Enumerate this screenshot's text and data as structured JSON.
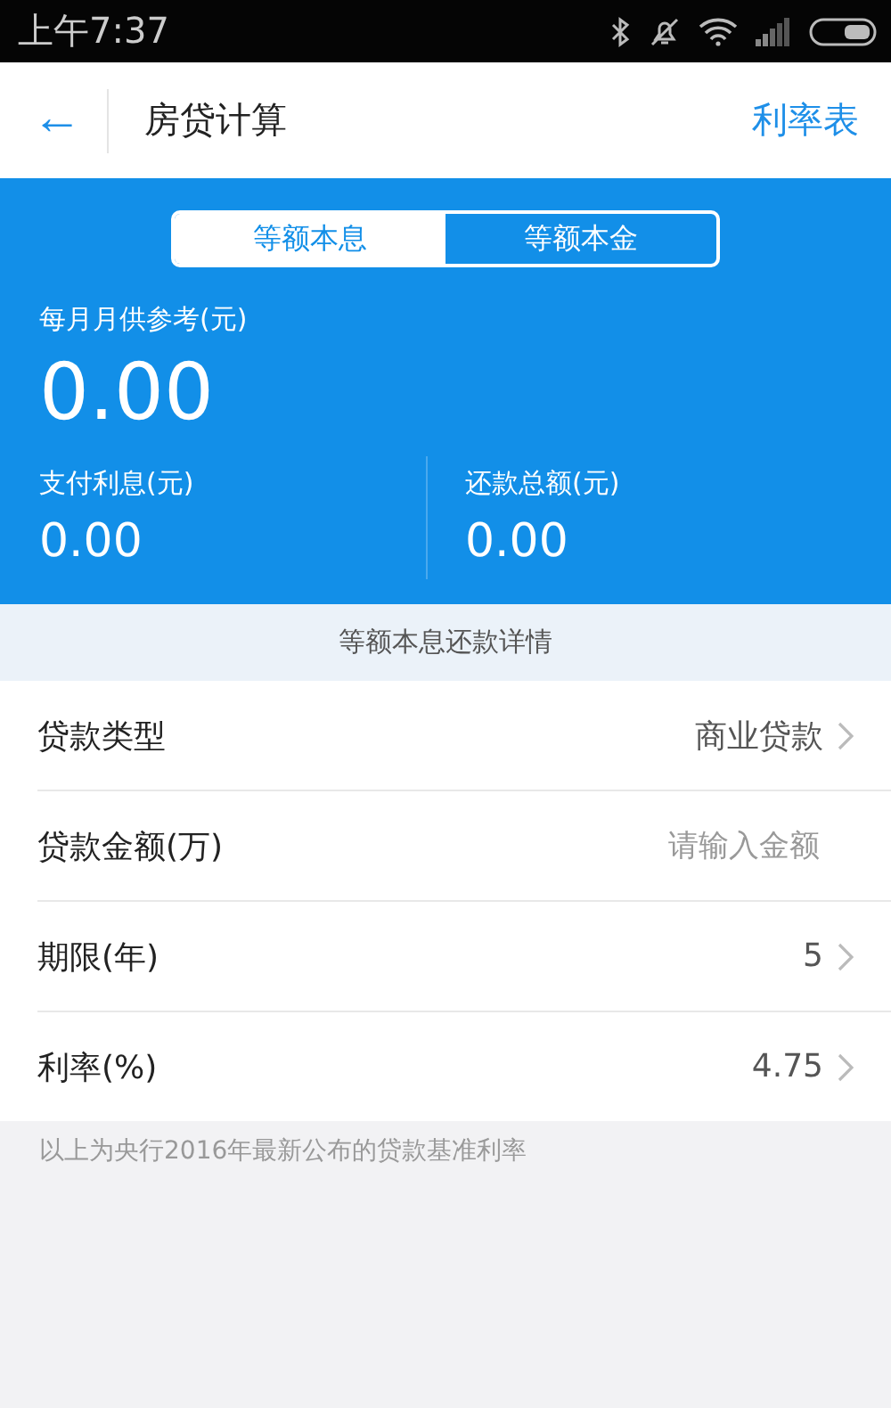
{
  "status_bar": {
    "time": "上午7:37"
  },
  "header": {
    "back": "←",
    "title": "房贷计算",
    "action": "利率表"
  },
  "tabs": [
    {
      "label": "等额本息",
      "selected": true
    },
    {
      "label": "等额本金",
      "selected": false
    }
  ],
  "summary": {
    "main_label": "每月月供参考(元)",
    "main_value": "0.00",
    "items": [
      {
        "label": "支付利息(元)",
        "value": "0.00"
      },
      {
        "label": "还款总额(元)",
        "value": "0.00"
      }
    ]
  },
  "details_link": "等额本息还款详情",
  "rows": [
    {
      "kind": "select",
      "label": "贷款类型",
      "value": "商业贷款"
    },
    {
      "kind": "input",
      "label": "贷款金额(万)",
      "placeholder": "请输入金额"
    },
    {
      "kind": "select",
      "label": "期限(年)",
      "value": "5"
    },
    {
      "kind": "select",
      "label": "利率(%)",
      "value": "4.75"
    }
  ],
  "note": "以上为央行2016年最新公布的贷款基准利率"
}
